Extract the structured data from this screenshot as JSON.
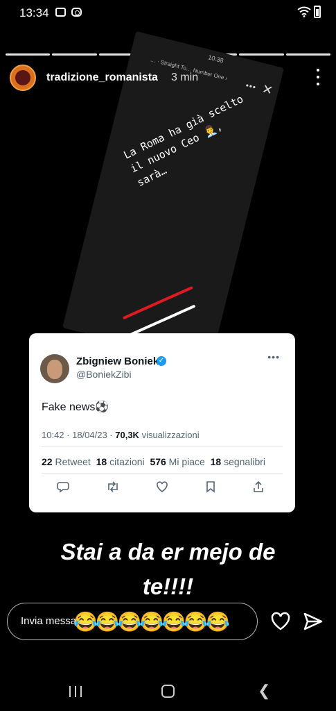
{
  "status_bar": {
    "time": "13:34"
  },
  "story": {
    "progress_segments": 7,
    "username": "tradizione_romanista",
    "time_ago": "3 min"
  },
  "reposted_story": {
    "clock": "10:38",
    "song": "… · Straight To… Number One ›",
    "text": "La Roma ha già scelto il nuovo Ceo 👨‍💼, sarà…"
  },
  "tweet": {
    "name": "Zbigniew Boniek",
    "handle": "@BoniekZibi",
    "text": "Fake news⚽",
    "time": "10:42 · 18/04/23 · ",
    "views_count": "70,3K",
    "views_label": " visualizzazioni",
    "retweets_count": "22",
    "retweets_label": " Retweet",
    "quotes_count": "18",
    "quotes_label": " citazioni",
    "likes_count": "576",
    "likes_label": " Mi piace",
    "bookmarks_count": "18",
    "bookmarks_label": " segnalibri"
  },
  "caption": {
    "line1": "Stai a da er mejo de",
    "line2": "te!!!!"
  },
  "reply": {
    "placeholder": "Invia messaggio",
    "emojis": "😂😂😂😂😂😂😂"
  }
}
